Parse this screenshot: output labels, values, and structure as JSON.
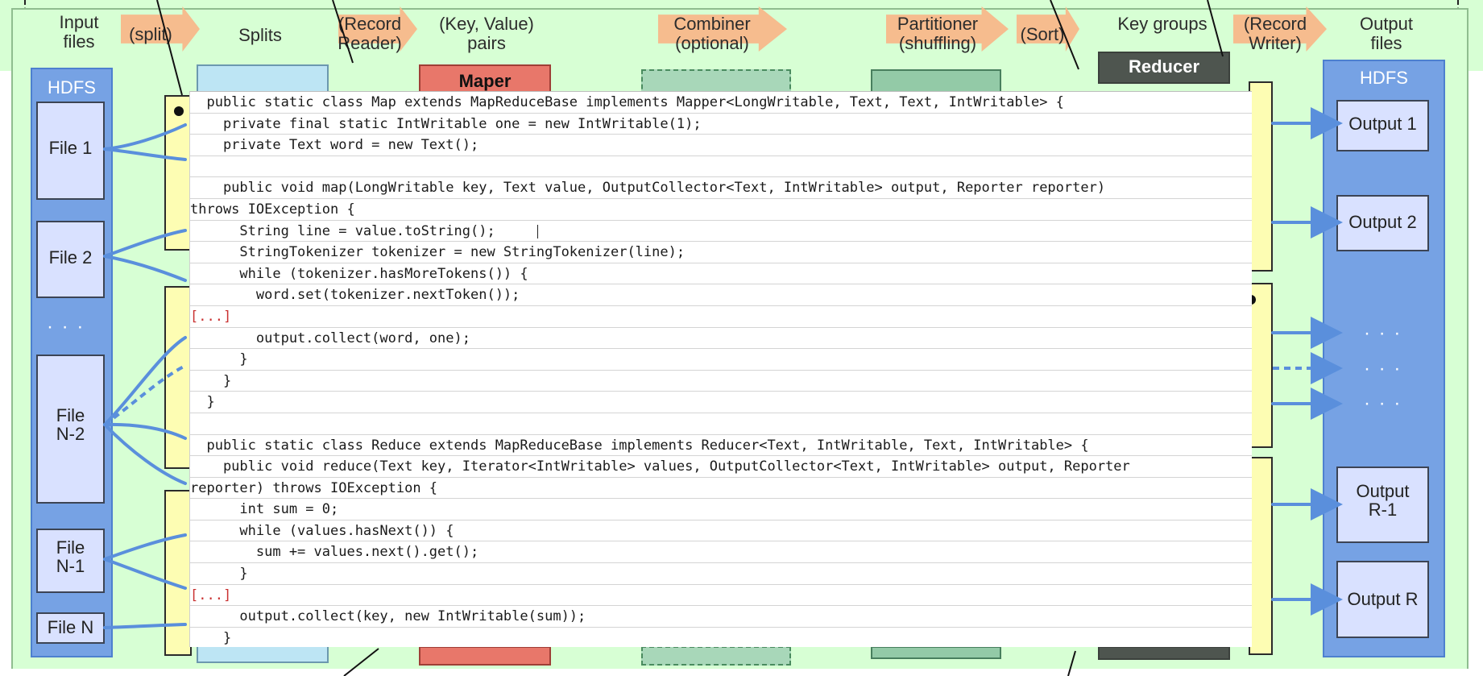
{
  "diagram": {
    "stage_labels": [
      "Input\nfiles",
      "(split)",
      "Splits",
      "(Record\nReader)",
      "(Key, Value)\npairs",
      "Combiner\n(optional)",
      "Partitioner\n(shuffling)",
      "(Sort)",
      "Key groups",
      "(Record\nWriter)",
      "Output\nfiles"
    ],
    "left_hdfs": {
      "title": "HDFS",
      "files": [
        "File 1",
        "File 2",
        "· · ·",
        "File\nN-2",
        "File\nN-1",
        "File N"
      ]
    },
    "right_hdfs": {
      "title": "HDFS",
      "outputs": [
        "Output 1",
        "Output 2",
        "· · ·",
        "· · ·",
        "· · ·",
        "Output\nR-1",
        "Output R"
      ]
    },
    "mapper": {
      "label": "Maper"
    },
    "reducer": {
      "label": "Reducer"
    }
  },
  "code": {
    "lines": [
      "  public static class Map extends MapReduceBase implements Mapper<LongWritable, Text, Text, IntWritable> {",
      "    private final static IntWritable one = new IntWritable(1);",
      "    private Text word = new Text();",
      "",
      "    public void map(LongWritable key, Text value, OutputCollector<Text, IntWritable> output, Reporter reporter)",
      "throws IOException {",
      "      String line = value.toString();",
      "      StringTokenizer tokenizer = new StringTokenizer(line);",
      "      while (tokenizer.hasMoreTokens()) {",
      "        word.set(tokenizer.nextToken());",
      "[...]",
      "        output.collect(word, one);",
      "      }",
      "    }",
      "  }",
      "",
      "  public static class Reduce extends MapReduceBase implements Reducer<Text, IntWritable, Text, IntWritable> {",
      "    public void reduce(Text key, Iterator<IntWritable> values, OutputCollector<Text, IntWritable> output, Reporter",
      "reporter) throws IOException {",
      "      int sum = 0;",
      "      while (values.hasNext()) {",
      "        sum += values.next().get();",
      "      }",
      "[...]",
      "      output.collect(key, new IntWritable(sum));",
      "    }"
    ]
  }
}
